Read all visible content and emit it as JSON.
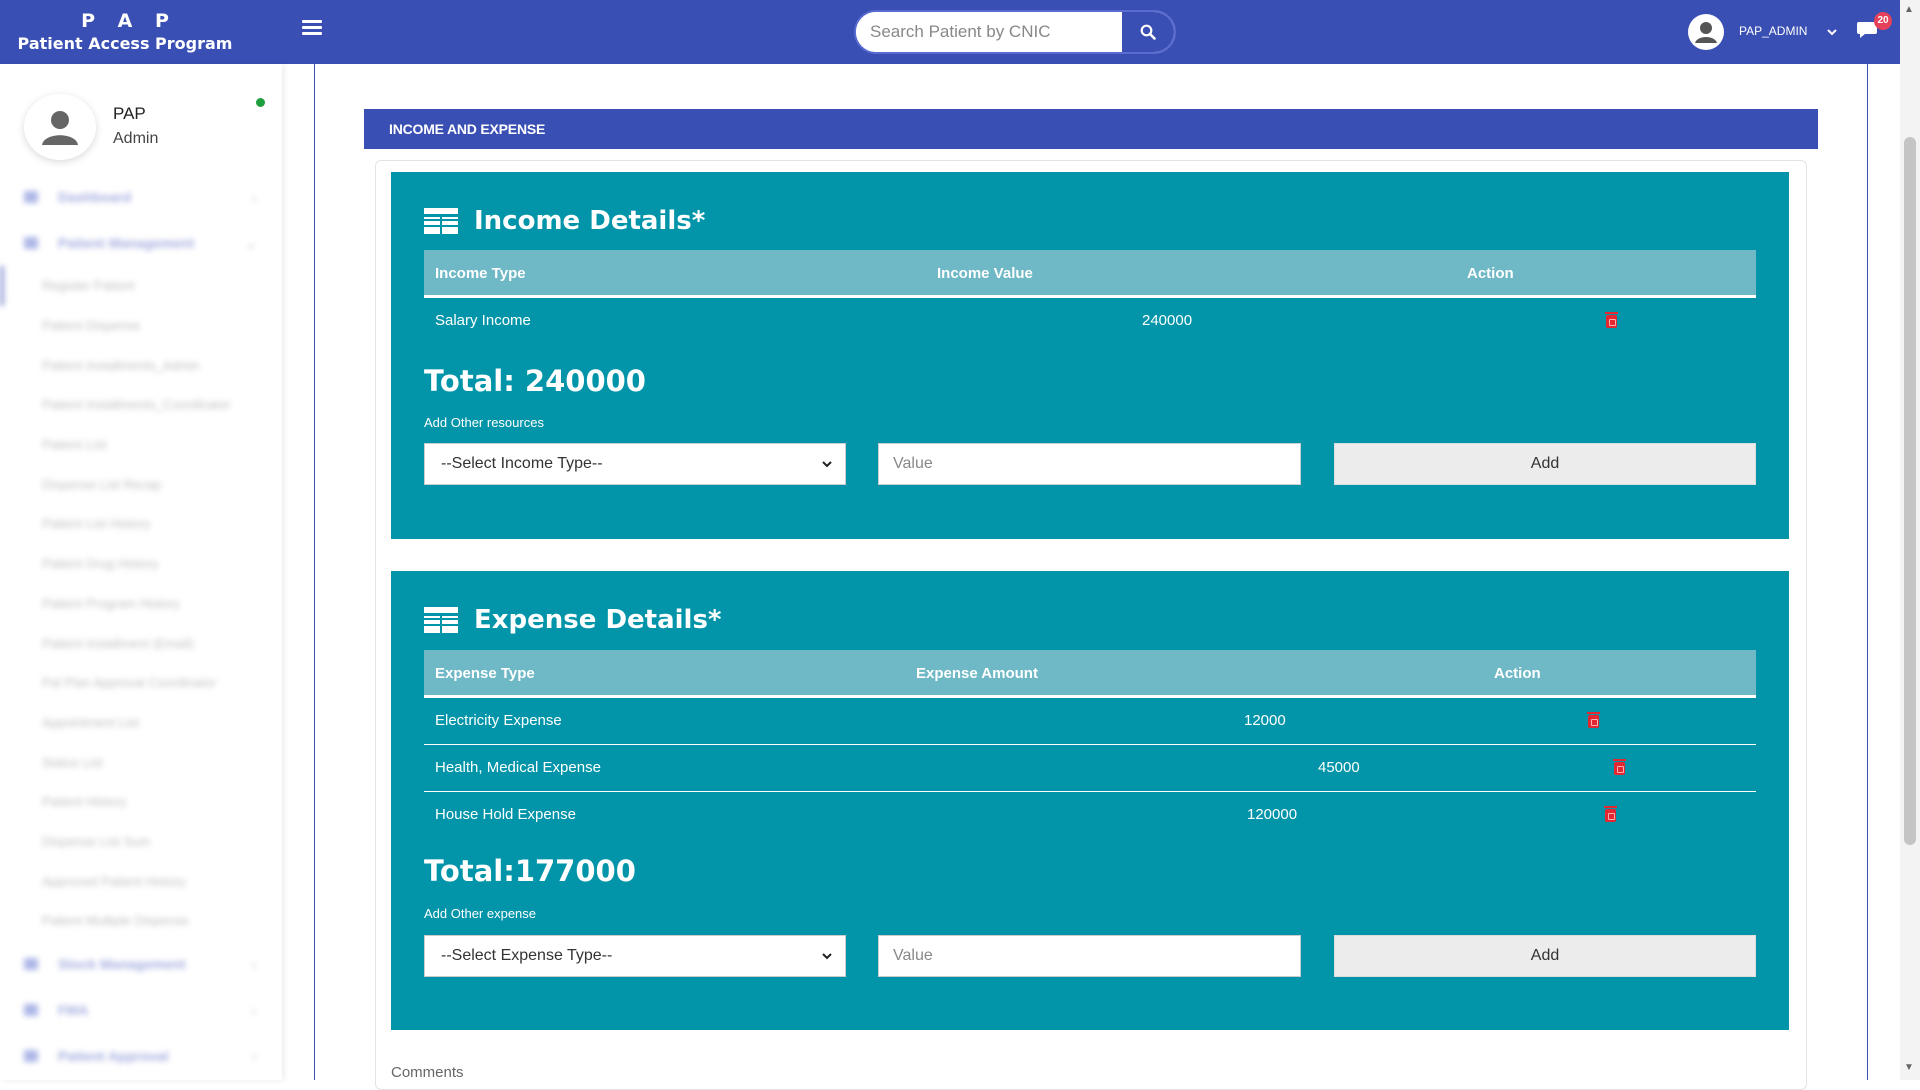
{
  "header": {
    "brand_title": "P A P",
    "brand_subtitle": "Patient Access Program",
    "search_placeholder": "Search Patient by CNIC",
    "user_name": "PAP_ADMIN",
    "notification_count": "20",
    "colors": {
      "bar": "#3a4fb4"
    }
  },
  "sidebar": {
    "profile_name": "PAP",
    "profile_role": "Admin",
    "status": "online",
    "nav": {
      "dashboard": "Dashboard",
      "patient_management": "Patient Management",
      "items": [
        "Register Patient",
        "Patient Dispense",
        "Patient Installments_Admin",
        "Patient Installments_Coordinator",
        "Patient List",
        "Dispense List Recap",
        "Patient List History",
        "Patient Drug History",
        "Patient Program History",
        "Patient Installment (Email)",
        "Pal Plan Approval Coordinator",
        "Appointment List",
        "Status List",
        "Patient History",
        "Dispense List Sum",
        "Approved Patient History",
        "Patient Multiple Dispense"
      ],
      "stock_management": "Stock Management",
      "fma": "FMA",
      "patient_approval": "Patient Approval"
    }
  },
  "main": {
    "section_title": "INCOME AND EXPENSE",
    "comments_label": "Comments",
    "panel_color": "#0295a9",
    "income": {
      "title": "Income Details*",
      "columns": [
        "Income Type",
        "Income Value",
        "Action"
      ],
      "rows": [
        {
          "type": "Salary Income",
          "value": "240000"
        }
      ],
      "total": "Total: 240000",
      "add_label": "Add Other resources",
      "select_placeholder": "--Select Income Type--",
      "value_placeholder": "Value",
      "add_button": "Add"
    },
    "expense": {
      "title": "Expense Details*",
      "columns": [
        "Expense Type",
        "Expense Amount",
        "Action"
      ],
      "rows": [
        {
          "type": "Electricity Expense",
          "value": "12000"
        },
        {
          "type": "Health, Medical Expense",
          "value": "45000"
        },
        {
          "type": "House Hold Expense",
          "value": "120000"
        }
      ],
      "total": "Total:177000",
      "add_label": "Add Other expense",
      "select_placeholder": "--Select Expense Type--",
      "value_placeholder": "Value",
      "add_button": "Add"
    }
  }
}
